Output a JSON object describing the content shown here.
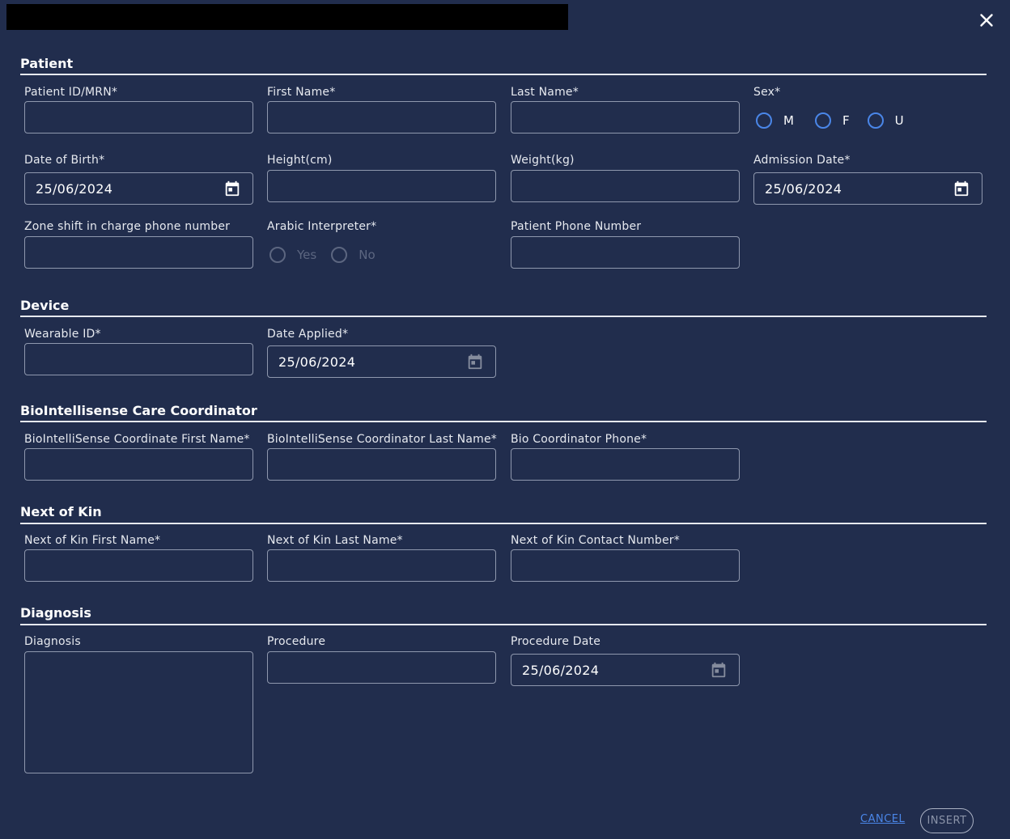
{
  "colors": {
    "background": "#212d4d",
    "accent": "#4a86e8",
    "border": "#8f98ae",
    "disabled": "#5c6680"
  },
  "icons": {
    "close": "close-icon",
    "calendar": "calendar-icon"
  },
  "sections": {
    "patient": "Patient",
    "device": "Device",
    "coordinator": "BioIntellisense Care Coordinator",
    "kin": "Next of Kin",
    "diagnosis": "Diagnosis"
  },
  "patient": {
    "patient_id_label": "Patient ID/MRN*",
    "first_name_label": "First Name*",
    "last_name_label": "Last Name*",
    "sex_label": "Sex*",
    "sex_options": [
      "M",
      "F",
      "U"
    ],
    "dob_label": "Date of Birth*",
    "dob_value": "25/06/2024",
    "height_label": "Height(cm)",
    "weight_label": "Weight(kg)",
    "admission_label": "Admission Date*",
    "admission_value": "25/06/2024",
    "zone_phone_label": "Zone shift in charge phone number",
    "interpreter_label": "Arabic Interpreter*",
    "interpreter_options": [
      "Yes",
      "No"
    ],
    "patient_phone_label": "Patient Phone Number"
  },
  "device": {
    "wearable_label": "Wearable ID*",
    "date_applied_label": "Date Applied*",
    "date_applied_value": "25/06/2024"
  },
  "coordinator": {
    "first_name_label": "BioIntelliSense Coordinate First Name*",
    "last_name_label": "BioIntelliSense Coordinator Last Name*",
    "phone_label": "Bio Coordinator Phone*"
  },
  "kin": {
    "first_name_label": "Next of Kin First Name*",
    "last_name_label": "Next of Kin Last Name*",
    "contact_label": "Next of Kin Contact Number*"
  },
  "diagnosis": {
    "diagnosis_label": "Diagnosis",
    "procedure_label": "Procedure",
    "procedure_date_label": "Procedure Date",
    "procedure_date_value": "25/06/2024"
  },
  "actions": {
    "cancel": "CANCEL",
    "insert": "INSERT"
  }
}
